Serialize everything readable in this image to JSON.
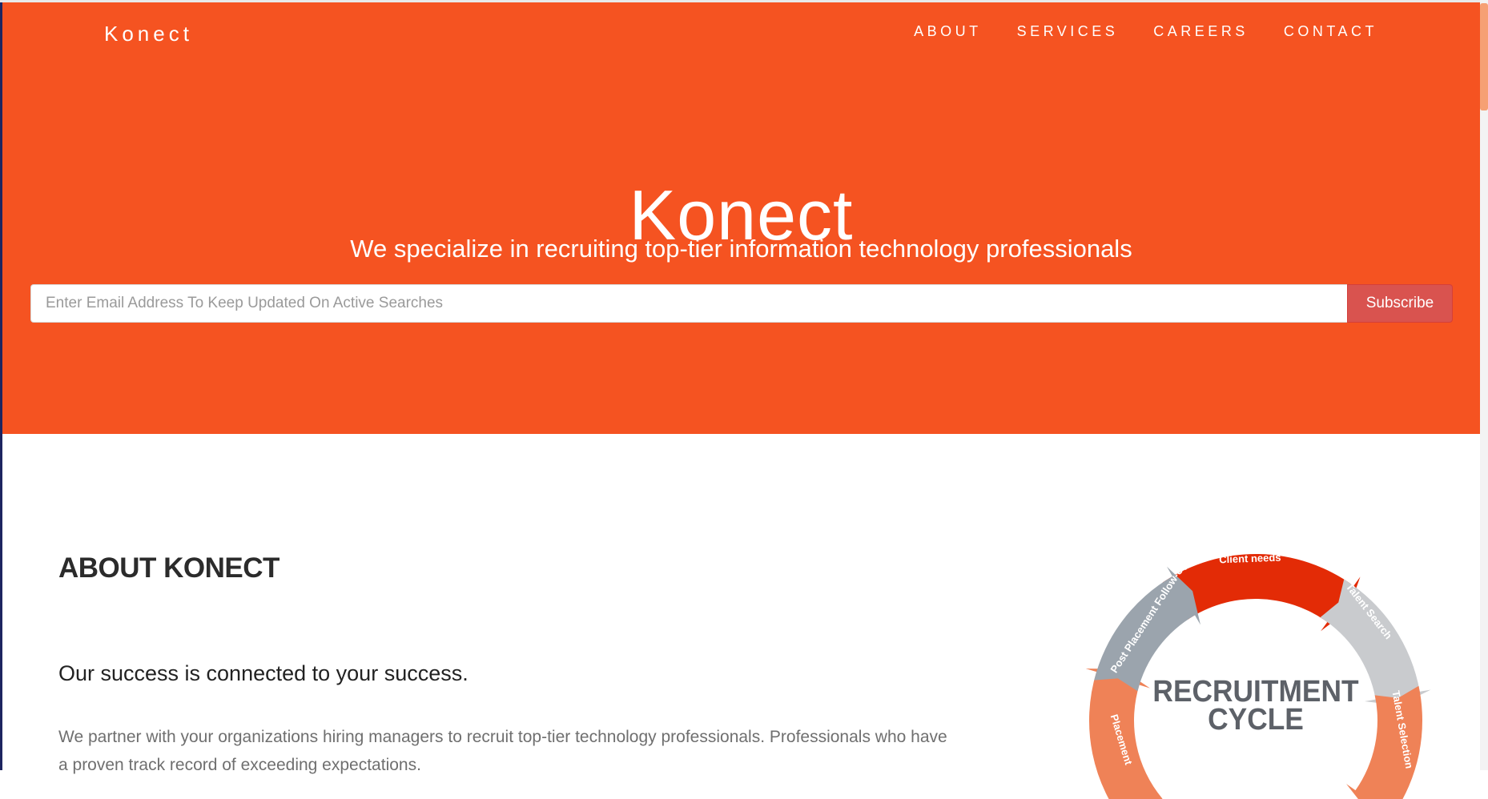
{
  "brand": "Konect",
  "nav": {
    "items": [
      "ABOUT",
      "SERVICES",
      "CAREERS",
      "CONTACT"
    ]
  },
  "hero": {
    "title": "Konect",
    "subtitle": "We specialize in recruiting top-tier information technology professionals"
  },
  "subscribe": {
    "placeholder": "Enter Email Address To Keep Updated On Active Searches",
    "value": "",
    "button_label": "Subscribe"
  },
  "about": {
    "heading": "ABOUT KONECT",
    "tagline": "Our success is connected to your success.",
    "body": "We partner with your organizations hiring managers to recruit top-tier technology professionals. Professionals who have a proven track record of exceeding expectations."
  },
  "recruitment_cycle": {
    "title_line1": "RECRUITMENT",
    "title_line2": "CYCLE",
    "stages": [
      "Client needs",
      "Talent Search",
      "Talent Selection",
      "Placement",
      "Post Placement Follow-Up"
    ]
  },
  "colors": {
    "hero_bg": "#f55321",
    "subscribe_button": "#d9534f",
    "cycle_red": "#e32b06",
    "cycle_light_gray": "#c9cbce",
    "cycle_salmon": "#ef8257",
    "cycle_slate": "#9ba4ad"
  }
}
